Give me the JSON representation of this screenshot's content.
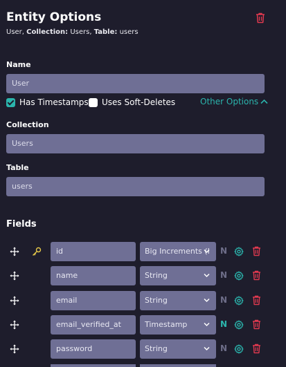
{
  "entity": {
    "title": "Entity Options",
    "subtitle": {
      "name": "User,",
      "collection_label": "Collection:",
      "collection_value": "Users,",
      "table_label": "Table:",
      "table_value": "users"
    }
  },
  "form": {
    "name_label": "Name",
    "name_value": "User",
    "has_timestamps_label": "Has Timestamps",
    "has_timestamps_checked": true,
    "soft_deletes_label": "Uses Soft-Deletes",
    "soft_deletes_checked": false,
    "other_options_label": "Other Options",
    "collection_label": "Collection",
    "collection_value": "Users",
    "table_label": "Table",
    "table_value": "users"
  },
  "fields_title": "Fields",
  "fields": [
    {
      "name": "id",
      "type": "Big Increments (I",
      "nullable": "N",
      "nullable_active": false,
      "primary_key": true
    },
    {
      "name": "name",
      "type": "String",
      "nullable": "N",
      "nullable_active": false,
      "primary_key": false
    },
    {
      "name": "email",
      "type": "String",
      "nullable": "N",
      "nullable_active": false,
      "primary_key": false
    },
    {
      "name": "email_verified_at",
      "type": "Timestamp",
      "nullable": "N",
      "nullable_active": true,
      "primary_key": false
    },
    {
      "name": "password",
      "type": "String",
      "nullable": "N",
      "nullable_active": false,
      "primary_key": false
    }
  ],
  "colors": {
    "background": "#1e1d2c",
    "input": "#6f6f95",
    "accent": "#2bb5ad",
    "danger": "#e0394f",
    "key": "#e6c84a"
  },
  "icons": {
    "delete": "trash-icon",
    "move": "move-icon",
    "primary_key": "key-icon",
    "settings": "gear-icon",
    "chevron": "chevron-down-icon",
    "collapse": "chevron-up-icon"
  }
}
